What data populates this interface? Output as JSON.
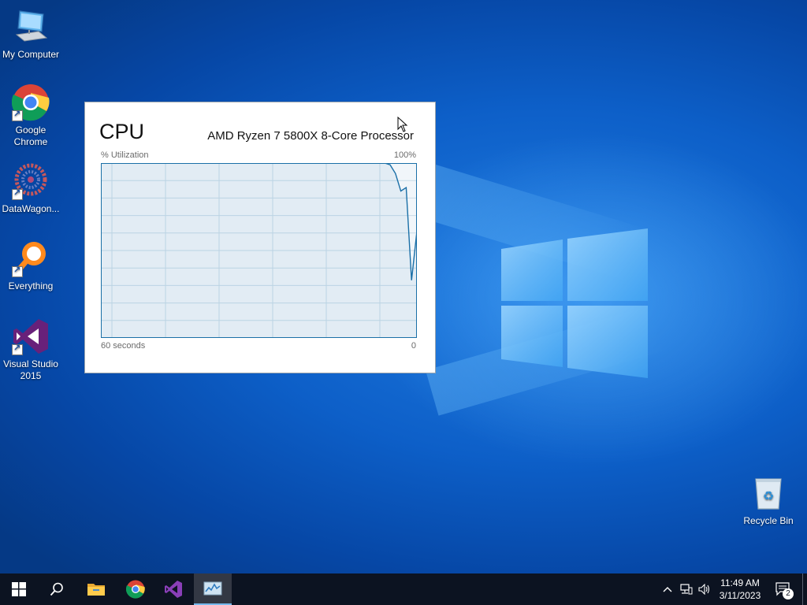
{
  "desktop": {
    "icons": [
      {
        "label": "My Computer",
        "icon": "computer-icon"
      },
      {
        "label": "Google Chrome",
        "icon": "chrome-icon"
      },
      {
        "label": "DataWagon...",
        "icon": "datawagon-icon"
      },
      {
        "label": "Everything",
        "icon": "everything-search-icon"
      },
      {
        "label": "Visual Studio 2015",
        "icon": "visual-studio-icon"
      },
      {
        "label": "Recycle Bin",
        "icon": "recycle-bin-icon"
      }
    ]
  },
  "cpu_widget": {
    "title": "CPU",
    "processor": "AMD Ryzen 7 5800X 8-Core Processor",
    "utilization_label": "% Utilization",
    "max_label": "100%",
    "time_left_label": "60 seconds",
    "time_right_label": "0",
    "line_color": "#1a6fa7",
    "utilization_history_percent": [
      100,
      100,
      100,
      100,
      100,
      100,
      100,
      100,
      100,
      100,
      100,
      100,
      100,
      100,
      100,
      100,
      100,
      100,
      100,
      100,
      100,
      100,
      100,
      100,
      100,
      100,
      100,
      100,
      100,
      100,
      100,
      100,
      100,
      100,
      100,
      100,
      100,
      100,
      100,
      100,
      100,
      100,
      100,
      100,
      100,
      100,
      100,
      100,
      100,
      100,
      100,
      100,
      100,
      100,
      99,
      94,
      84,
      86,
      33,
      61
    ]
  },
  "taskbar": {
    "items": [
      {
        "name": "start-button",
        "icon": "windows-start-icon"
      },
      {
        "name": "search-button",
        "icon": "search-icon"
      },
      {
        "name": "file-explorer-button",
        "icon": "folder-icon"
      },
      {
        "name": "chrome-taskbar-button",
        "icon": "chrome-icon"
      },
      {
        "name": "visual-studio-taskbar-button",
        "icon": "visual-studio-icon"
      },
      {
        "name": "task-manager-taskbar-button",
        "icon": "task-manager-icon",
        "active": true
      }
    ],
    "clock_time": "11:49 AM",
    "clock_date": "3/11/2023",
    "notification_count": "2"
  },
  "colors": {
    "desktop_blue": "#0d5fc8",
    "taskbar_bg": "#0c1321",
    "graph_grid": "#c8dbe8",
    "graph_fill": "#f1f6fa"
  }
}
